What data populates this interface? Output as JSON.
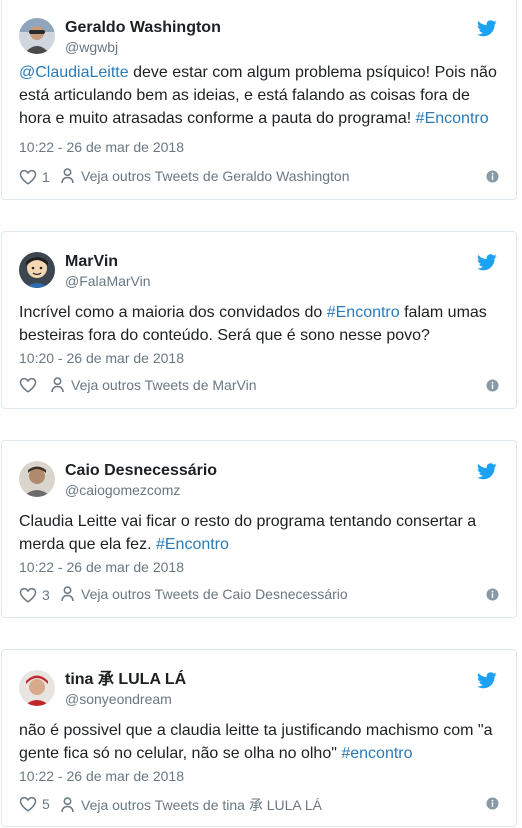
{
  "colors": {
    "link": "#2b7bb9",
    "muted": "#697882",
    "bird": "#1da1f2"
  },
  "tweets": [
    {
      "name": "Geraldo Washington",
      "handle": "@wgwbj",
      "text_parts": [
        {
          "t": "@ClaudiaLeitte",
          "k": "mention"
        },
        {
          "t": " deve estar com algum problema psíquico! Pois não está articulando bem as ideias, e está falando as coisas fora de hora e muito atrasadas conforme a pauta do programa! ",
          "k": "plain"
        },
        {
          "t": "#Encontro",
          "k": "hashtag"
        }
      ],
      "time": "10:22 - 26 de mar de 2018",
      "likes": "1",
      "profile_link": "Veja outros Tweets de Geraldo Washington"
    },
    {
      "name": "MarVin",
      "handle": "@FalaMarVin",
      "text_parts": [
        {
          "t": "Incrível como a maioria dos convidados do ",
          "k": "plain"
        },
        {
          "t": "#Encontro",
          "k": "hashtag"
        },
        {
          "t": " falam umas besteiras fora do conteúdo. Será que é sono nesse povo?",
          "k": "plain"
        }
      ],
      "time": "10:20 - 26 de mar de 2018",
      "likes": "",
      "profile_link": "Veja outros Tweets de MarVin"
    },
    {
      "name": "Caio Desnecessário",
      "handle": "@caiogomezcomz",
      "text_parts": [
        {
          "t": "Claudia Leitte vai ficar o resto do programa tentando consertar a merda que ela fez. ",
          "k": "plain"
        },
        {
          "t": "#Encontro",
          "k": "hashtag"
        }
      ],
      "time": "10:22 - 26 de mar de 2018",
      "likes": "3",
      "profile_link": "Veja outros Tweets de Caio Desnecessário"
    },
    {
      "name": "tina 承 LULA LÁ",
      "handle": "@sonyeondream",
      "text_parts": [
        {
          "t": "não é possivel que a claudia leitte ta justificando machismo com \"a gente fica só no celular, não se olha no olho\" ",
          "k": "plain"
        },
        {
          "t": "#encontro",
          "k": "hashtag"
        }
      ],
      "time": "10:22 - 26 de mar de 2018",
      "likes": "5",
      "profile_link": "Veja outros Tweets de tina 承 LULA LÁ"
    }
  ]
}
